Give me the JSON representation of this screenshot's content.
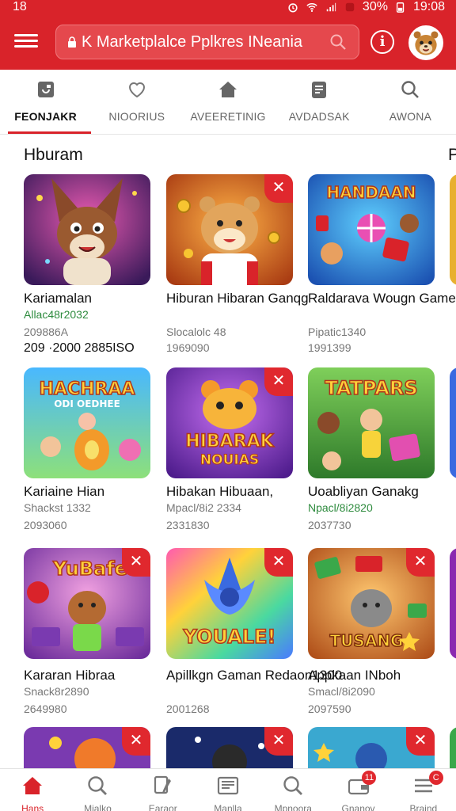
{
  "status_bar": {
    "left_time": "18",
    "battery": "30%",
    "time": "19:08"
  },
  "app_bar": {
    "search_text": "K Marketplalce Pplkres INeania"
  },
  "tabs": [
    {
      "label": "FEONJAKR",
      "icon": "store-icon",
      "active": true
    },
    {
      "label": "NIOORIUS",
      "icon": "heart-icon",
      "active": false
    },
    {
      "label": "AVEERETINIG",
      "icon": "home-icon",
      "active": false
    },
    {
      "label": "AVDADSAK",
      "icon": "document-icon",
      "active": false
    },
    {
      "label": "AWONA",
      "icon": "search-icon",
      "active": false
    }
  ],
  "section": {
    "title": "Hburam",
    "next_title_fragment": "P"
  },
  "cards": [
    {
      "title": "Kariamalan",
      "meta1": "Allac48r2032",
      "meta2": "209886A",
      "extra": "209 ·2000 2885ISO",
      "close": false,
      "thumb": "fox-party"
    },
    {
      "title": "Hiburan Hibaran Ganqg",
      "meta1": "Slocalolc 48",
      "meta2": "1969090",
      "extra": "",
      "close": true,
      "thumb": "hamster-coins"
    },
    {
      "title": "Raldarava Wougn Game",
      "meta1": "Pipatic1340",
      "meta2": "1991399",
      "extra": "",
      "close": false,
      "thumb": "handaan-ball"
    },
    {
      "title": "Kariaine Hian",
      "meta1": "Shackst 1332",
      "meta2": "2093060",
      "extra": "",
      "close": false,
      "thumb": "hachraa"
    },
    {
      "title": "Hibakan Hibuaan,",
      "meta1": "Mpacl/8i2 2334",
      "meta2": "2331830",
      "extra": "",
      "close": true,
      "thumb": "hibarak"
    },
    {
      "title": "Uoabliyan Ganakg",
      "meta1": "Npacl/8i2820",
      "meta2": "2037730",
      "extra": "",
      "close": false,
      "thumb": "tatpars"
    },
    {
      "title": "Kararan Hibraa",
      "meta1": "Snack8r2890",
      "meta2": "2649980",
      "extra": "",
      "close": true,
      "thumb": "yubafe"
    },
    {
      "title": "Apillkgn Gaman Redaon1300",
      "meta1": "",
      "meta2": "2001268",
      "extra": "",
      "close": true,
      "thumb": "youale"
    },
    {
      "title": "Appkaan INboh",
      "meta1": "Smacl/8i2090",
      "meta2": "2097590",
      "extra": "",
      "close": true,
      "thumb": "tusangx"
    },
    {
      "title": "",
      "meta1": "",
      "meta2": "",
      "extra": "",
      "close": true,
      "thumb": "row4a"
    },
    {
      "title": "",
      "meta1": "",
      "meta2": "",
      "extra": "",
      "close": true,
      "thumb": "row4b"
    },
    {
      "title": "",
      "meta1": "",
      "meta2": "",
      "extra": "",
      "close": true,
      "thumb": "row4c"
    }
  ],
  "thumb_words": {
    "handaan": "HANDAAN",
    "hachraa": "HACHRAA",
    "hachraa_sub": "ODI OEDHEE",
    "hibarak": "HIBARAK",
    "hibarak_sub": "NOUIAS",
    "tatpars": "TATPARS",
    "yubafe": "YuBafe",
    "youale": "YOUALE!",
    "tusangx": "TUSANG"
  },
  "bottom_nav": [
    {
      "label": "Hans",
      "icon": "home-icon",
      "active": true,
      "badge": ""
    },
    {
      "label": "Mialko",
      "icon": "search-icon",
      "active": false,
      "badge": ""
    },
    {
      "label": "Earaor",
      "icon": "edit-icon",
      "active": false,
      "badge": ""
    },
    {
      "label": "Manlla",
      "icon": "news-icon",
      "active": false,
      "badge": ""
    },
    {
      "label": "Mpnoora",
      "icon": "search-icon",
      "active": false,
      "badge": ""
    },
    {
      "label": "Gnanov",
      "icon": "wallet-icon",
      "active": false,
      "badge": "11"
    },
    {
      "label": "Braind",
      "icon": "menu-icon",
      "active": false,
      "badge": "C"
    }
  ],
  "colors": {
    "brand_red": "#d9232a",
    "meta_green": "#2e8b3e"
  }
}
